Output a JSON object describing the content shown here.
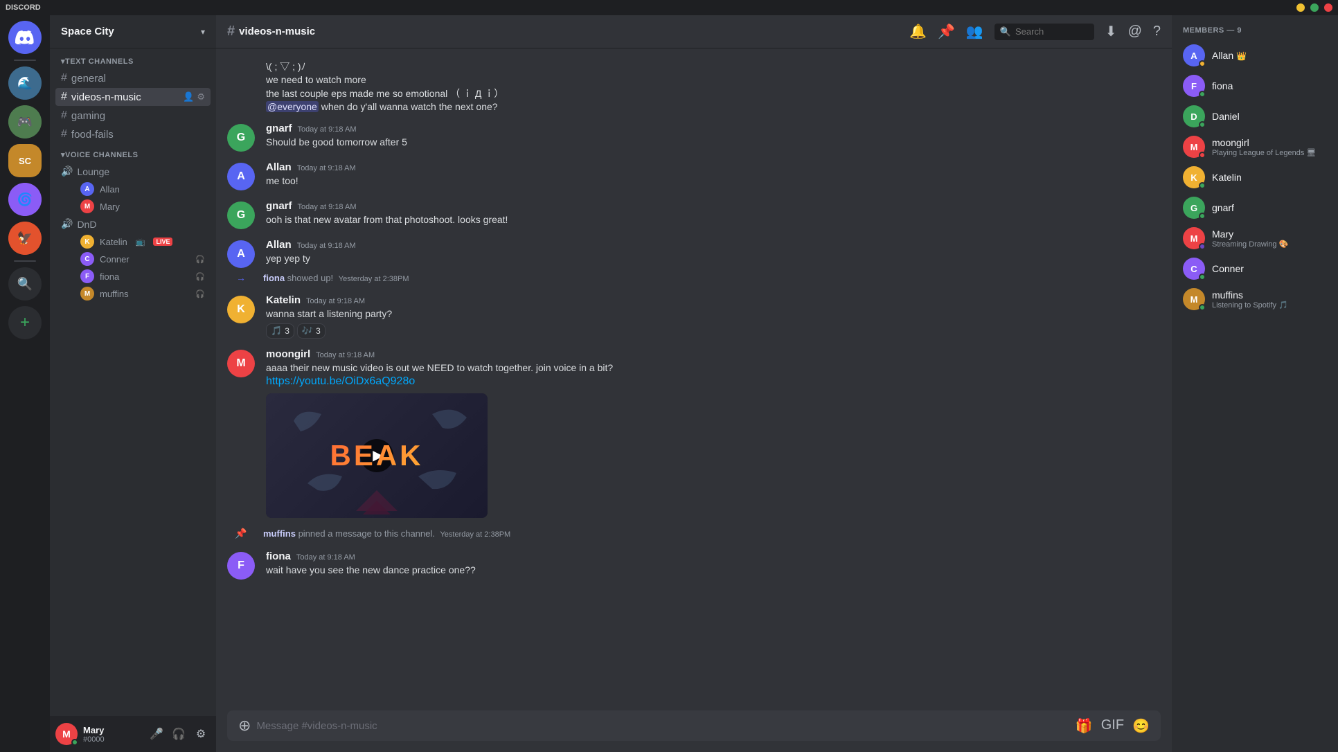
{
  "app": {
    "title": "DISCORD",
    "window_controls": [
      "minimize",
      "maximize",
      "close"
    ]
  },
  "server": {
    "name": "Space City",
    "dropdown_icon": "▾"
  },
  "channels": {
    "text_channels_header": "TEXT CHANNELS",
    "voice_channels_header": "VOICE CHANNELS",
    "items": [
      {
        "id": "general",
        "name": "general",
        "type": "text"
      },
      {
        "id": "videos-n-music",
        "name": "videos-n-music",
        "type": "text",
        "active": true
      },
      {
        "id": "gaming",
        "name": "gaming",
        "type": "text"
      },
      {
        "id": "food-fails",
        "name": "food-fails",
        "type": "text"
      }
    ],
    "voice_channels": [
      {
        "id": "lounge",
        "name": "Lounge",
        "members": [
          {
            "name": "Allan",
            "color": "#5865f2"
          },
          {
            "name": "Mary",
            "color": "#ed4245"
          }
        ]
      },
      {
        "id": "dnd",
        "name": "DnD",
        "members": [
          {
            "name": "Katelin",
            "color": "#3ba55c",
            "live": true
          },
          {
            "name": "Conner",
            "color": "#8b5cf6"
          },
          {
            "name": "fiona",
            "color": "#f0b132"
          },
          {
            "name": "muffins",
            "color": "#ed4245"
          }
        ]
      }
    ]
  },
  "chat_header": {
    "channel_name": "videos-n-music",
    "hash": "#",
    "actions": [
      "bell",
      "pin",
      "members",
      "search",
      "download",
      "globe",
      "help"
    ],
    "search_placeholder": "Search"
  },
  "messages": [
    {
      "id": "msg1",
      "type": "continuation",
      "lines": [
        "\\( ; ▽ ; )ﾉ",
        "we need to watch more",
        "the last couple eps made me so emotional （ ｉ Д ｉ）"
      ],
      "mention_line": "@everyone when do y'all wanna watch the next one?"
    },
    {
      "id": "msg2",
      "type": "message",
      "author": "gnarf",
      "avatar_color": "#3ba55c",
      "avatar_letter": "G",
      "time": "Today at 9:18 AM",
      "text": "Should be good tomorrow after 5"
    },
    {
      "id": "msg3",
      "type": "message",
      "author": "Allan",
      "avatar_color": "#5865f2",
      "avatar_letter": "A",
      "time": "Today at 9:18 AM",
      "text": "me too!"
    },
    {
      "id": "msg4",
      "type": "message",
      "author": "gnarf",
      "avatar_color": "#3ba55c",
      "avatar_letter": "G",
      "time": "Today at 9:18 AM",
      "text": "ooh is that new avatar from that photoshoot. looks great!"
    },
    {
      "id": "msg5",
      "type": "message",
      "author": "Allan",
      "avatar_color": "#5865f2",
      "avatar_letter": "A",
      "time": "Today at 9:18 AM",
      "text": "yep yep ty"
    },
    {
      "id": "sys1",
      "type": "system",
      "icon": "→",
      "text_parts": [
        "fiona",
        " showed up!"
      ],
      "time": "Yesterday at 2:38PM"
    },
    {
      "id": "msg6",
      "type": "message",
      "author": "Katelin",
      "avatar_color": "#f0b132",
      "avatar_letter": "K",
      "time": "Today at 9:18 AM",
      "text": "wanna start a listening party?",
      "reactions": [
        {
          "emoji": "🎵",
          "count": 3
        },
        {
          "emoji": "🎵",
          "count": 3
        }
      ]
    },
    {
      "id": "msg7",
      "type": "message",
      "author": "moongirl",
      "avatar_color": "#ed4245",
      "avatar_letter": "M",
      "time": "Today at 9:18 AM",
      "text": "aaaa their new music video is out we NEED to watch together. join voice in a bit?",
      "link": "https://youtu.be/OiDx6aQ928o",
      "has_video": true,
      "video_title": "BEAK"
    },
    {
      "id": "sys2",
      "type": "system",
      "icon": "📌",
      "text_parts": [
        "muffins",
        " pinned a message to this channel."
      ],
      "time": "Yesterday at 2:38PM"
    },
    {
      "id": "msg8",
      "type": "message",
      "author": "fiona",
      "avatar_color": "#8b5cf6",
      "avatar_letter": "F",
      "time": "Today at 9:18 AM",
      "text": "wait have you see the new dance practice one??"
    }
  ],
  "message_input": {
    "placeholder": "Message #videos-n-music"
  },
  "members": {
    "header": "MEMBERS — 9",
    "items": [
      {
        "name": "Allan",
        "color": "#5865f2",
        "letter": "A",
        "badge": "👑",
        "status": "online"
      },
      {
        "name": "fiona",
        "color": "#8b5cf6",
        "letter": "F",
        "status": "online"
      },
      {
        "name": "Daniel",
        "color": "#3ba55c",
        "letter": "D",
        "status": "online"
      },
      {
        "name": "moongirl",
        "color": "#ed4245",
        "letter": "M",
        "activity": "Playing League of Legends",
        "status": "dnd"
      },
      {
        "name": "Katelin",
        "color": "#f0b132",
        "letter": "K",
        "status": "online"
      },
      {
        "name": "gnarf",
        "color": "#3ba55c",
        "letter": "G",
        "status": "online"
      },
      {
        "name": "Mary",
        "color": "#ed4245",
        "letter": "M",
        "activity": "Streaming Drawing 🎨",
        "status": "streaming"
      },
      {
        "name": "Conner",
        "color": "#8b5cf6",
        "letter": "C",
        "status": "online"
      },
      {
        "name": "muffins",
        "color": "#c4882a",
        "letter": "M",
        "activity": "Listening to Spotify 🎵",
        "status": "online"
      }
    ]
  },
  "current_user": {
    "name": "Mary",
    "discriminator": "#0000",
    "color": "#ed4245",
    "letter": "M"
  },
  "server_icons": [
    {
      "id": "home",
      "letter": "⚡",
      "color": "#5865f2"
    },
    {
      "id": "s1",
      "letter": "🌊",
      "color": "#3d6b8e"
    },
    {
      "id": "s2",
      "letter": "🎮",
      "color": "#4e7c4f"
    },
    {
      "id": "s3",
      "letter": "SC",
      "color": "#c4882a"
    },
    {
      "id": "s4",
      "letter": "🌀",
      "color": "#8b5cf6"
    },
    {
      "id": "s5",
      "letter": "🦅",
      "color": "#e3522d"
    }
  ],
  "left_nav_icons": [
    {
      "id": "search",
      "icon": "🔍",
      "label": "search-nav"
    },
    {
      "id": "add",
      "icon": "+",
      "label": "add-server"
    }
  ]
}
